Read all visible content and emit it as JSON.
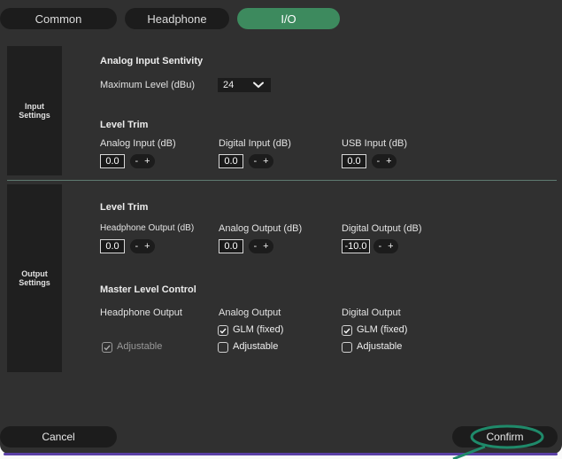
{
  "tabs": [
    {
      "label": "Common"
    },
    {
      "label": "Headphone"
    },
    {
      "label": "I/O"
    }
  ],
  "input_settings": {
    "side_label": "Input\nSettings",
    "sensitivity_header": "Analog Input Sentivity",
    "max_level_label": "Maximum Level (dBu)",
    "max_level_value": "24",
    "level_trim_header": "Level Trim",
    "fields": [
      {
        "label": "Analog Input (dB)",
        "value": "0.0"
      },
      {
        "label": "Digital Input (dB)",
        "value": "0.0"
      },
      {
        "label": "USB Input (dB)",
        "value": "0.0"
      }
    ]
  },
  "output_settings": {
    "side_label": "Output\nSettings",
    "level_trim_header": "Level Trim",
    "fields": [
      {
        "label": "Headphone Output (dB)",
        "value": "0.0"
      },
      {
        "label": "Analog Output (dB)",
        "value": "0.0"
      },
      {
        "label": "Digital Output (dB)",
        "value": "-10.0"
      }
    ],
    "master_header": "Master Level Control",
    "columns": [
      {
        "label": "Headphone Output"
      },
      {
        "label": "Analog Output"
      },
      {
        "label": "Digital Output"
      }
    ],
    "glm_fixed_label": "GLM (fixed)",
    "adjustable_label": "Adjustable"
  },
  "stepper": {
    "minus": "-",
    "plus": "+"
  },
  "footer": {
    "cancel": "Cancel",
    "confirm": "Confirm"
  },
  "colors": {
    "active_tab": "#3d8a5e",
    "annotation": "#1f8a6a"
  }
}
